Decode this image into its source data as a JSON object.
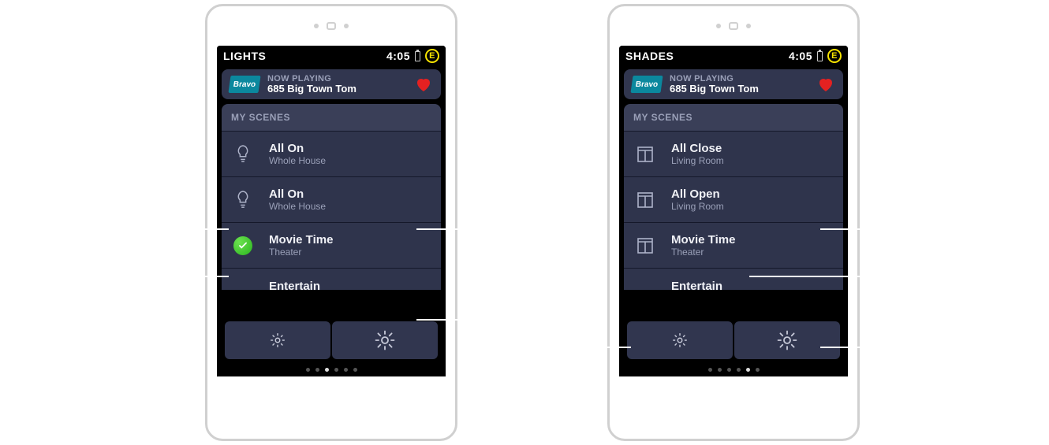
{
  "devices": [
    {
      "status": {
        "title": "LIGHTS",
        "time": "4:05",
        "badge": "E"
      },
      "now_playing": {
        "logo_text": "Bravo",
        "label": "NOW PLAYING",
        "track": "685  Big Town Tom"
      },
      "section_label": "MY SCENES",
      "rows": [
        {
          "icon": "bulb",
          "title": "All On",
          "sub": "Whole House"
        },
        {
          "icon": "bulb",
          "title": "All On",
          "sub": "Whole House"
        },
        {
          "icon": "check",
          "title": "Movie Time",
          "sub": "Theater"
        },
        {
          "icon": "none",
          "title": "Entertain",
          "sub": ""
        }
      ],
      "pager": {
        "count": 6,
        "active": 2
      }
    },
    {
      "status": {
        "title": "SHADES",
        "time": "4:05",
        "badge": "E"
      },
      "now_playing": {
        "logo_text": "Bravo",
        "label": "NOW PLAYING",
        "track": "685  Big Town Tom"
      },
      "section_label": "MY SCENES",
      "rows": [
        {
          "icon": "shade",
          "title": "All Close",
          "sub": "Living Room"
        },
        {
          "icon": "shade",
          "title": "All Open",
          "sub": "Living Room"
        },
        {
          "icon": "shade",
          "title": "Movie Time",
          "sub": "Theater"
        },
        {
          "icon": "none",
          "title": "Entertain",
          "sub": ""
        }
      ],
      "pager": {
        "count": 6,
        "active": 4
      }
    }
  ]
}
